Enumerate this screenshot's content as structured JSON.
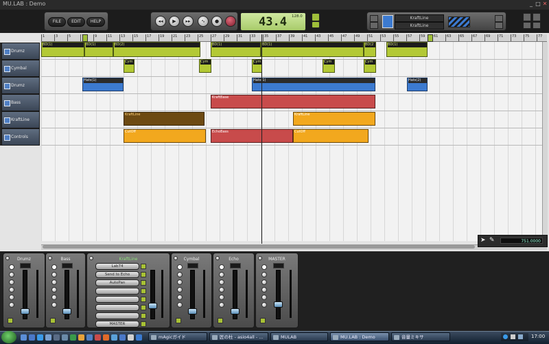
{
  "window": {
    "title": "MU.LAB : Demo"
  },
  "toolbar": {
    "file": "FILE",
    "edit": "EDIT",
    "help": "HELP",
    "lcd_time": "43.4",
    "lcd_tempo": "128.0",
    "nav_top": "KraftLine",
    "nav_bottom": "KraftLine"
  },
  "ruler": {
    "marks": [
      "1",
      "3",
      "5",
      "7",
      "9",
      "11",
      "13",
      "15",
      "17",
      "19",
      "21",
      "23",
      "25",
      "27",
      "29",
      "31",
      "33",
      "35",
      "37",
      "39",
      "41",
      "43",
      "45",
      "47",
      "49",
      "51",
      "53",
      "55",
      "57",
      "59",
      "61",
      "63",
      "65",
      "67",
      "69",
      "71",
      "73",
      "75",
      "77"
    ]
  },
  "tracks": [
    {
      "name": "Drumz"
    },
    {
      "name": "Cymbal"
    },
    {
      "name": "Drumz"
    },
    {
      "name": "Bass"
    },
    {
      "name": "KraftLine"
    },
    {
      "name": "Controls"
    }
  ],
  "clips": [
    {
      "lane": 0,
      "label": "BD(1)",
      "style": "green"
    },
    {
      "lane": 0,
      "label": "BD(1)",
      "style": "green"
    },
    {
      "lane": 0,
      "label": "BD(2)",
      "style": "green"
    },
    {
      "lane": 0,
      "label": "BD(1)",
      "style": "green"
    },
    {
      "lane": 0,
      "label": "BD(1)",
      "style": "green"
    },
    {
      "lane": 0,
      "label": "BD(2",
      "style": "green"
    },
    {
      "lane": 0,
      "label": "BD(1)",
      "style": "green"
    },
    {
      "lane": 1,
      "label": "Cym",
      "style": "green"
    },
    {
      "lane": 1,
      "label": "Cym",
      "style": "green"
    },
    {
      "lane": 1,
      "label": "Cym",
      "style": "green"
    },
    {
      "lane": 1,
      "label": "Cym",
      "style": "green"
    },
    {
      "lane": 1,
      "label": "Cym",
      "style": "green"
    },
    {
      "lane": 2,
      "label": "Hats(1)",
      "style": "blue"
    },
    {
      "lane": 2,
      "label": "Hats(1)",
      "style": "blue"
    },
    {
      "lane": 2,
      "label": "Hats(2)",
      "style": "blue"
    },
    {
      "lane": 3,
      "label": "KraftBase",
      "style": "red"
    },
    {
      "lane": 4,
      "label": "KraftLine",
      "style": "brown"
    },
    {
      "lane": 4,
      "label": "KraftLine",
      "style": "orange"
    },
    {
      "lane": 5,
      "label": "CutOff",
      "style": "orange"
    },
    {
      "lane": 5,
      "label": "EchoBass",
      "style": "red"
    },
    {
      "lane": 5,
      "label": "CutOff",
      "style": "orange"
    }
  ],
  "tools": {
    "position": "751.0000"
  },
  "mixer": {
    "strips": [
      {
        "name": "Drumz"
      },
      {
        "name": "Bass"
      },
      {
        "name": "KraftLine",
        "accent": "#8ee07a"
      },
      {
        "name": "Cymbal"
      },
      {
        "name": "Echo"
      },
      {
        "name": "MASTER"
      }
    ],
    "kraftline_slots": [
      "Lab74",
      "Send to Echo",
      "AutoPan",
      "",
      "",
      "",
      "",
      "MASTER"
    ]
  },
  "taskbar": {
    "items": [
      "mAgicガイド",
      "匠の杜 - asio4all - ...",
      "MULAB",
      "MU.LAB : Demo",
      "音量ミキサ"
    ],
    "clock": "17:00"
  },
  "colors": {
    "clip_green": "#b3c935",
    "clip_blue": "#3c7ad0",
    "clip_red": "#c84b4b",
    "clip_orange": "#f2a81e",
    "track_header": "#4a5668"
  }
}
